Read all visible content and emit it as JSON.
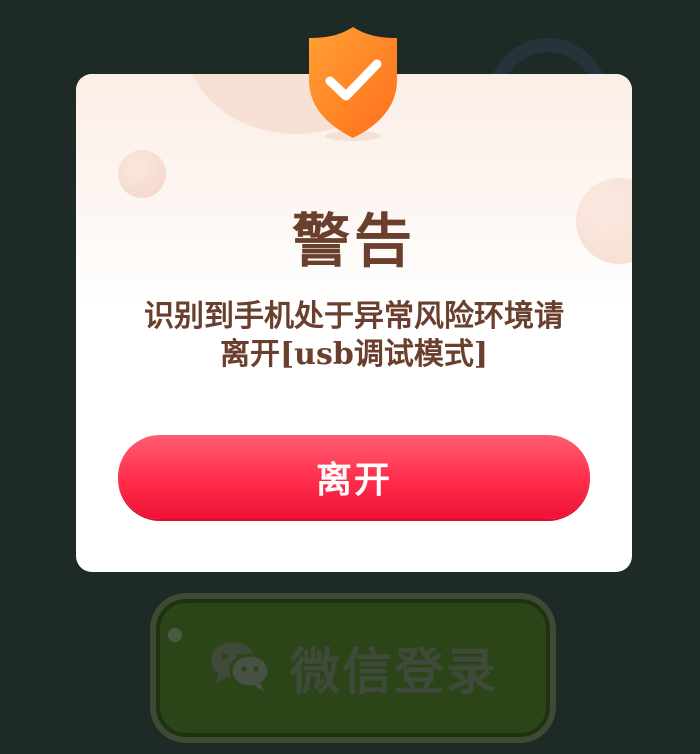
{
  "dialog": {
    "title": "警告",
    "message_line1": "识别到手机处于异常风险环境请",
    "message_line2": "离开[usb调试模式]",
    "leave_button_label": "离开"
  },
  "background": {
    "login_button_label": "微信登录"
  },
  "colors": {
    "overlay_background": "#1d2a26",
    "dialog_background": "#ffffff",
    "text_brown": "#6b3f2e",
    "button_red": "#ff2c4a",
    "shield_orange": "#ff8a25"
  },
  "icons": {
    "shield": "shield-check-icon",
    "wechat": "wechat-icon"
  }
}
